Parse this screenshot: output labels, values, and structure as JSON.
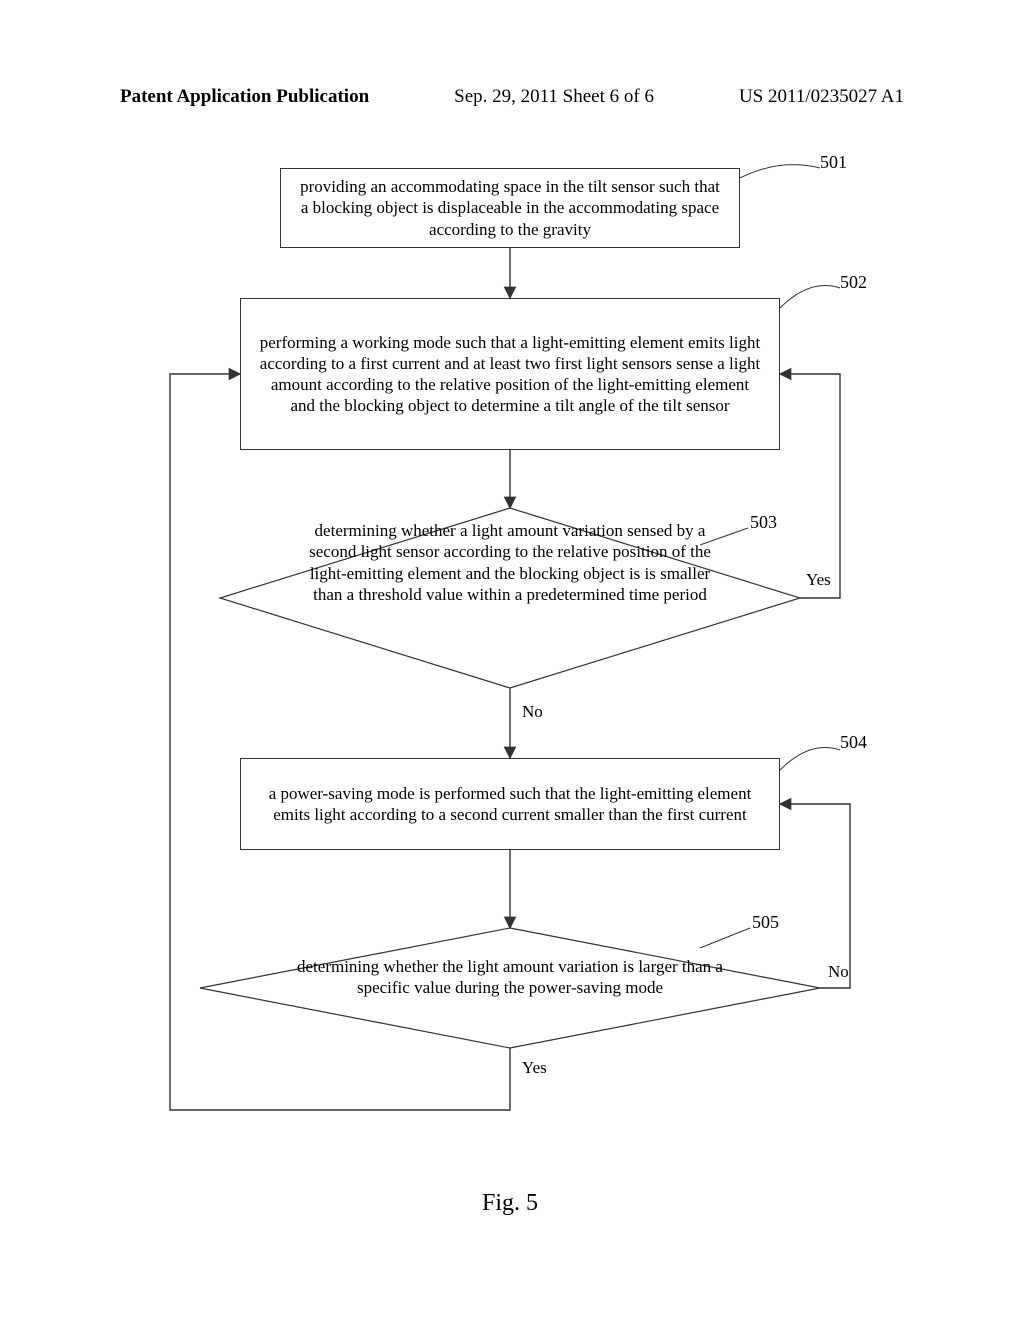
{
  "header": {
    "left": "Patent Application Publication",
    "center": "Sep. 29, 2011  Sheet 6 of 6",
    "right": "US 2011/0235027 A1"
  },
  "labels": {
    "n501": "501",
    "n502": "502",
    "n503": "503",
    "n504": "504",
    "n505": "505"
  },
  "steps": {
    "s501": "providing an accommodating space in the tilt sensor such that a blocking object is displaceable in the accommodating space according to the gravity",
    "s502": "performing a working mode such that a light-emitting element emits light according to a first current and at least two first light sensors sense a light amount according to the relative position of the light-emitting element and the blocking object to determine a tilt angle of the tilt sensor",
    "s503": "determining whether a light amount variation sensed by a second light sensor according to the relative position of the light-emitting element and the blocking object is is smaller than a threshold value within a predetermined time period",
    "s504": "a power-saving mode is performed such that the light-emitting element emits light according to a second current smaller than the first current",
    "s505": "determining whether the light amount variation is larger than a specific value during the power-saving mode"
  },
  "edges": {
    "yes": "Yes",
    "no": "No"
  },
  "caption": "Fig. 5"
}
